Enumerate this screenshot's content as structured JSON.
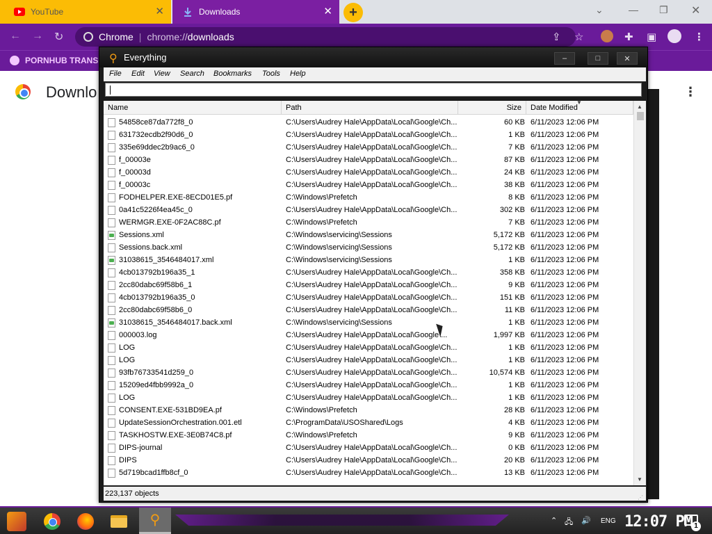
{
  "browser": {
    "tabs": [
      {
        "title": "YouTube",
        "icon": "youtube-icon"
      },
      {
        "title": "Downloads",
        "icon": "download-icon"
      }
    ],
    "new_tab": "+",
    "url_host_label": "Chrome",
    "url_scheme": "chrome://",
    "url_path": "downloads",
    "bookmark": "PORNHUB TRANS",
    "page_title": "Downlo",
    "colors": {
      "accent": "#6a1b9a",
      "youtube_tab": "#fbbc05"
    }
  },
  "everything": {
    "title": "Everything",
    "menu": [
      "File",
      "Edit",
      "View",
      "Search",
      "Bookmarks",
      "Tools",
      "Help"
    ],
    "search_value": "",
    "columns": [
      "Name",
      "Path",
      "Size",
      "Date Modified"
    ],
    "rows": [
      {
        "name": "54858ce87da772f8_0",
        "path": "C:\\Users\\Audrey Hale\\AppData\\Local\\Google\\Ch...",
        "size": "60 KB",
        "date": "6/11/2023 12:06 PM",
        "icon": "file"
      },
      {
        "name": "631732ecdb2f90d6_0",
        "path": "C:\\Users\\Audrey Hale\\AppData\\Local\\Google\\Ch...",
        "size": "1 KB",
        "date": "6/11/2023 12:06 PM",
        "icon": "file"
      },
      {
        "name": "335e69ddec2b9ac6_0",
        "path": "C:\\Users\\Audrey Hale\\AppData\\Local\\Google\\Ch...",
        "size": "7 KB",
        "date": "6/11/2023 12:06 PM",
        "icon": "file"
      },
      {
        "name": "f_00003e",
        "path": "C:\\Users\\Audrey Hale\\AppData\\Local\\Google\\Ch...",
        "size": "87 KB",
        "date": "6/11/2023 12:06 PM",
        "icon": "file"
      },
      {
        "name": "f_00003d",
        "path": "C:\\Users\\Audrey Hale\\AppData\\Local\\Google\\Ch...",
        "size": "24 KB",
        "date": "6/11/2023 12:06 PM",
        "icon": "file"
      },
      {
        "name": "f_00003c",
        "path": "C:\\Users\\Audrey Hale\\AppData\\Local\\Google\\Ch...",
        "size": "38 KB",
        "date": "6/11/2023 12:06 PM",
        "icon": "file"
      },
      {
        "name": "FODHELPER.EXE-8ECD01E5.pf",
        "path": "C:\\Windows\\Prefetch",
        "size": "8 KB",
        "date": "6/11/2023 12:06 PM",
        "icon": "file"
      },
      {
        "name": "0a41c5226f4ea45c_0",
        "path": "C:\\Users\\Audrey Hale\\AppData\\Local\\Google\\Ch...",
        "size": "302 KB",
        "date": "6/11/2023 12:06 PM",
        "icon": "file"
      },
      {
        "name": "WERMGR.EXE-0F2AC88C.pf",
        "path": "C:\\Windows\\Prefetch",
        "size": "7 KB",
        "date": "6/11/2023 12:06 PM",
        "icon": "file"
      },
      {
        "name": "Sessions.xml",
        "path": "C:\\Windows\\servicing\\Sessions",
        "size": "5,172 KB",
        "date": "6/11/2023 12:06 PM",
        "icon": "xml"
      },
      {
        "name": "Sessions.back.xml",
        "path": "C:\\Windows\\servicing\\Sessions",
        "size": "5,172 KB",
        "date": "6/11/2023 12:06 PM",
        "icon": "file"
      },
      {
        "name": "31038615_3546484017.xml",
        "path": "C:\\Windows\\servicing\\Sessions",
        "size": "1 KB",
        "date": "6/11/2023 12:06 PM",
        "icon": "xml"
      },
      {
        "name": "4cb013792b196a35_1",
        "path": "C:\\Users\\Audrey Hale\\AppData\\Local\\Google\\Ch...",
        "size": "358 KB",
        "date": "6/11/2023 12:06 PM",
        "icon": "file"
      },
      {
        "name": "2cc80dabc69f58b6_1",
        "path": "C:\\Users\\Audrey Hale\\AppData\\Local\\Google\\Ch...",
        "size": "9 KB",
        "date": "6/11/2023 12:06 PM",
        "icon": "file"
      },
      {
        "name": "4cb013792b196a35_0",
        "path": "C:\\Users\\Audrey Hale\\AppData\\Local\\Google\\Ch...",
        "size": "151 KB",
        "date": "6/11/2023 12:06 PM",
        "icon": "file"
      },
      {
        "name": "2cc80dabc69f58b6_0",
        "path": "C:\\Users\\Audrey Hale\\AppData\\Local\\Google\\Ch...",
        "size": "11 KB",
        "date": "6/11/2023 12:06 PM",
        "icon": "file"
      },
      {
        "name": "31038615_3546484017.back.xml",
        "path": "C:\\Windows\\servicing\\Sessions",
        "size": "1 KB",
        "date": "6/11/2023 12:06 PM",
        "icon": "xml"
      },
      {
        "name": "000003.log",
        "path": "C:\\Users\\Audrey Hale\\AppData\\Local\\Google\\...",
        "size": "1,997 KB",
        "date": "6/11/2023 12:06 PM",
        "icon": "file"
      },
      {
        "name": "LOG",
        "path": "C:\\Users\\Audrey Hale\\AppData\\Local\\Google\\Ch...",
        "size": "1 KB",
        "date": "6/11/2023 12:06 PM",
        "icon": "file"
      },
      {
        "name": "LOG",
        "path": "C:\\Users\\Audrey Hale\\AppData\\Local\\Google\\Ch...",
        "size": "1 KB",
        "date": "6/11/2023 12:06 PM",
        "icon": "file"
      },
      {
        "name": "93fb76733541d259_0",
        "path": "C:\\Users\\Audrey Hale\\AppData\\Local\\Google\\Ch...",
        "size": "10,574 KB",
        "date": "6/11/2023 12:06 PM",
        "icon": "file"
      },
      {
        "name": "15209ed4fbb9992a_0",
        "path": "C:\\Users\\Audrey Hale\\AppData\\Local\\Google\\Ch...",
        "size": "1 KB",
        "date": "6/11/2023 12:06 PM",
        "icon": "file"
      },
      {
        "name": "LOG",
        "path": "C:\\Users\\Audrey Hale\\AppData\\Local\\Google\\Ch...",
        "size": "1 KB",
        "date": "6/11/2023 12:06 PM",
        "icon": "file"
      },
      {
        "name": "CONSENT.EXE-531BD9EA.pf",
        "path": "C:\\Windows\\Prefetch",
        "size": "28 KB",
        "date": "6/11/2023 12:06 PM",
        "icon": "file"
      },
      {
        "name": "UpdateSessionOrchestration.001.etl",
        "path": "C:\\ProgramData\\USOShared\\Logs",
        "size": "4 KB",
        "date": "6/11/2023 12:06 PM",
        "icon": "file"
      },
      {
        "name": "TASKHOSTW.EXE-3E0B74C8.pf",
        "path": "C:\\Windows\\Prefetch",
        "size": "9 KB",
        "date": "6/11/2023 12:06 PM",
        "icon": "file"
      },
      {
        "name": "DIPS-journal",
        "path": "C:\\Users\\Audrey Hale\\AppData\\Local\\Google\\Ch...",
        "size": "0 KB",
        "date": "6/11/2023 12:06 PM",
        "icon": "file"
      },
      {
        "name": "DIPS",
        "path": "C:\\Users\\Audrey Hale\\AppData\\Local\\Google\\Ch...",
        "size": "20 KB",
        "date": "6/11/2023 12:06 PM",
        "icon": "file"
      },
      {
        "name": "5d719bcad1ffb8cf_0",
        "path": "C:\\Users\\Audrey Hale\\AppData\\Local\\Google\\Ch...",
        "size": "13 KB",
        "date": "6/11/2023 12:06 PM",
        "icon": "file"
      }
    ],
    "status": "223,137 objects"
  },
  "taskbar": {
    "lang": "ENG",
    "clock": "12:07 PM",
    "notifications": "1"
  }
}
